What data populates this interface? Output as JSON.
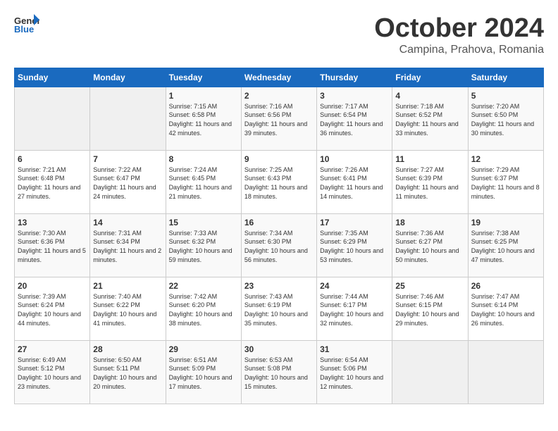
{
  "logo": {
    "general": "General",
    "blue": "Blue"
  },
  "title": "October 2024",
  "location": "Campina, Prahova, Romania",
  "days_of_week": [
    "Sunday",
    "Monday",
    "Tuesday",
    "Wednesday",
    "Thursday",
    "Friday",
    "Saturday"
  ],
  "weeks": [
    [
      {
        "day": "",
        "sunrise": "",
        "sunset": "",
        "daylight": "",
        "empty": true
      },
      {
        "day": "",
        "sunrise": "",
        "sunset": "",
        "daylight": "",
        "empty": true
      },
      {
        "day": "1",
        "sunrise": "Sunrise: 7:15 AM",
        "sunset": "Sunset: 6:58 PM",
        "daylight": "Daylight: 11 hours and 42 minutes."
      },
      {
        "day": "2",
        "sunrise": "Sunrise: 7:16 AM",
        "sunset": "Sunset: 6:56 PM",
        "daylight": "Daylight: 11 hours and 39 minutes."
      },
      {
        "day": "3",
        "sunrise": "Sunrise: 7:17 AM",
        "sunset": "Sunset: 6:54 PM",
        "daylight": "Daylight: 11 hours and 36 minutes."
      },
      {
        "day": "4",
        "sunrise": "Sunrise: 7:18 AM",
        "sunset": "Sunset: 6:52 PM",
        "daylight": "Daylight: 11 hours and 33 minutes."
      },
      {
        "day": "5",
        "sunrise": "Sunrise: 7:20 AM",
        "sunset": "Sunset: 6:50 PM",
        "daylight": "Daylight: 11 hours and 30 minutes."
      }
    ],
    [
      {
        "day": "6",
        "sunrise": "Sunrise: 7:21 AM",
        "sunset": "Sunset: 6:48 PM",
        "daylight": "Daylight: 11 hours and 27 minutes."
      },
      {
        "day": "7",
        "sunrise": "Sunrise: 7:22 AM",
        "sunset": "Sunset: 6:47 PM",
        "daylight": "Daylight: 11 hours and 24 minutes."
      },
      {
        "day": "8",
        "sunrise": "Sunrise: 7:24 AM",
        "sunset": "Sunset: 6:45 PM",
        "daylight": "Daylight: 11 hours and 21 minutes."
      },
      {
        "day": "9",
        "sunrise": "Sunrise: 7:25 AM",
        "sunset": "Sunset: 6:43 PM",
        "daylight": "Daylight: 11 hours and 18 minutes."
      },
      {
        "day": "10",
        "sunrise": "Sunrise: 7:26 AM",
        "sunset": "Sunset: 6:41 PM",
        "daylight": "Daylight: 11 hours and 14 minutes."
      },
      {
        "day": "11",
        "sunrise": "Sunrise: 7:27 AM",
        "sunset": "Sunset: 6:39 PM",
        "daylight": "Daylight: 11 hours and 11 minutes."
      },
      {
        "day": "12",
        "sunrise": "Sunrise: 7:29 AM",
        "sunset": "Sunset: 6:37 PM",
        "daylight": "Daylight: 11 hours and 8 minutes."
      }
    ],
    [
      {
        "day": "13",
        "sunrise": "Sunrise: 7:30 AM",
        "sunset": "Sunset: 6:36 PM",
        "daylight": "Daylight: 11 hours and 5 minutes."
      },
      {
        "day": "14",
        "sunrise": "Sunrise: 7:31 AM",
        "sunset": "Sunset: 6:34 PM",
        "daylight": "Daylight: 11 hours and 2 minutes."
      },
      {
        "day": "15",
        "sunrise": "Sunrise: 7:33 AM",
        "sunset": "Sunset: 6:32 PM",
        "daylight": "Daylight: 10 hours and 59 minutes."
      },
      {
        "day": "16",
        "sunrise": "Sunrise: 7:34 AM",
        "sunset": "Sunset: 6:30 PM",
        "daylight": "Daylight: 10 hours and 56 minutes."
      },
      {
        "day": "17",
        "sunrise": "Sunrise: 7:35 AM",
        "sunset": "Sunset: 6:29 PM",
        "daylight": "Daylight: 10 hours and 53 minutes."
      },
      {
        "day": "18",
        "sunrise": "Sunrise: 7:36 AM",
        "sunset": "Sunset: 6:27 PM",
        "daylight": "Daylight: 10 hours and 50 minutes."
      },
      {
        "day": "19",
        "sunrise": "Sunrise: 7:38 AM",
        "sunset": "Sunset: 6:25 PM",
        "daylight": "Daylight: 10 hours and 47 minutes."
      }
    ],
    [
      {
        "day": "20",
        "sunrise": "Sunrise: 7:39 AM",
        "sunset": "Sunset: 6:24 PM",
        "daylight": "Daylight: 10 hours and 44 minutes."
      },
      {
        "day": "21",
        "sunrise": "Sunrise: 7:40 AM",
        "sunset": "Sunset: 6:22 PM",
        "daylight": "Daylight: 10 hours and 41 minutes."
      },
      {
        "day": "22",
        "sunrise": "Sunrise: 7:42 AM",
        "sunset": "Sunset: 6:20 PM",
        "daylight": "Daylight: 10 hours and 38 minutes."
      },
      {
        "day": "23",
        "sunrise": "Sunrise: 7:43 AM",
        "sunset": "Sunset: 6:19 PM",
        "daylight": "Daylight: 10 hours and 35 minutes."
      },
      {
        "day": "24",
        "sunrise": "Sunrise: 7:44 AM",
        "sunset": "Sunset: 6:17 PM",
        "daylight": "Daylight: 10 hours and 32 minutes."
      },
      {
        "day": "25",
        "sunrise": "Sunrise: 7:46 AM",
        "sunset": "Sunset: 6:15 PM",
        "daylight": "Daylight: 10 hours and 29 minutes."
      },
      {
        "day": "26",
        "sunrise": "Sunrise: 7:47 AM",
        "sunset": "Sunset: 6:14 PM",
        "daylight": "Daylight: 10 hours and 26 minutes."
      }
    ],
    [
      {
        "day": "27",
        "sunrise": "Sunrise: 6:49 AM",
        "sunset": "Sunset: 5:12 PM",
        "daylight": "Daylight: 10 hours and 23 minutes."
      },
      {
        "day": "28",
        "sunrise": "Sunrise: 6:50 AM",
        "sunset": "Sunset: 5:11 PM",
        "daylight": "Daylight: 10 hours and 20 minutes."
      },
      {
        "day": "29",
        "sunrise": "Sunrise: 6:51 AM",
        "sunset": "Sunset: 5:09 PM",
        "daylight": "Daylight: 10 hours and 17 minutes."
      },
      {
        "day": "30",
        "sunrise": "Sunrise: 6:53 AM",
        "sunset": "Sunset: 5:08 PM",
        "daylight": "Daylight: 10 hours and 15 minutes."
      },
      {
        "day": "31",
        "sunrise": "Sunrise: 6:54 AM",
        "sunset": "Sunset: 5:06 PM",
        "daylight": "Daylight: 10 hours and 12 minutes."
      },
      {
        "day": "",
        "sunrise": "",
        "sunset": "",
        "daylight": "",
        "empty": true
      },
      {
        "day": "",
        "sunrise": "",
        "sunset": "",
        "daylight": "",
        "empty": true
      }
    ]
  ]
}
